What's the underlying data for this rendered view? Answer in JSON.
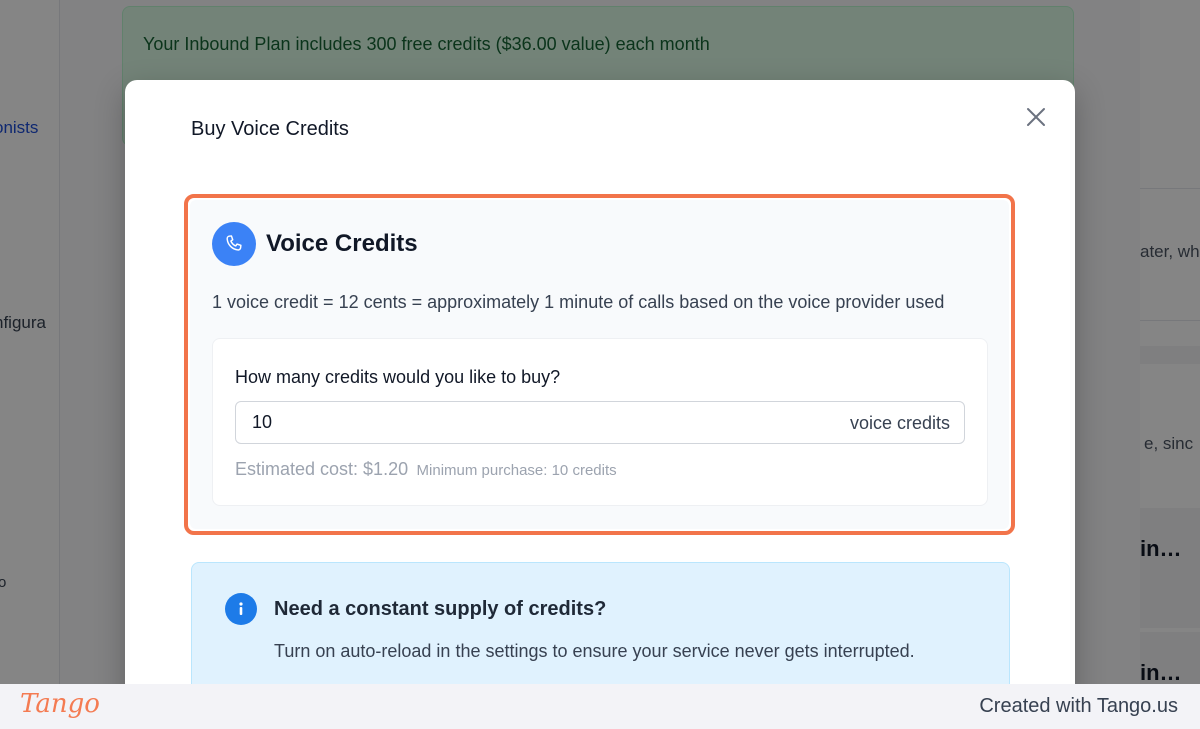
{
  "background": {
    "banner_text": "Your Inbound Plan includes 300 free credits ($36.00 value) each month",
    "sidebar_active_partial": "onists",
    "sidebar_config_partial": "nfigura",
    "sidebar_small_partial": "o",
    "right_partial_1": "ater, wh",
    "right_partial_2": "e, sinc",
    "right_partial_3": "in…",
    "right_partial_4": "in…"
  },
  "modal": {
    "title": "Buy Voice Credits",
    "close_icon": "close-icon",
    "voice_card": {
      "icon": "phone-icon",
      "title": "Voice Credits",
      "description": "1 voice credit = 12 cents = approximately 1 minute of calls based on the voice provider used",
      "question": "How many credits would you like to buy?",
      "input_value": "10",
      "input_suffix": "voice credits",
      "estimated_cost": "Estimated cost: $1.20",
      "minimum_purchase": "Minimum purchase: 10 credits"
    },
    "info_card": {
      "icon": "info-icon",
      "title": "Need a constant supply of credits?",
      "description": "Turn on auto-reload in the settings to ensure your service never gets interrupted."
    }
  },
  "footer": {
    "logo_text": "Tango",
    "credit_text": "Created with Tango.us"
  },
  "colors": {
    "highlight": "#f2744a",
    "accent_blue": "#3b82f6",
    "info_bg": "#e0f2fe",
    "banner_green": "#dcfce7",
    "tango_orange": "#f47b52"
  }
}
